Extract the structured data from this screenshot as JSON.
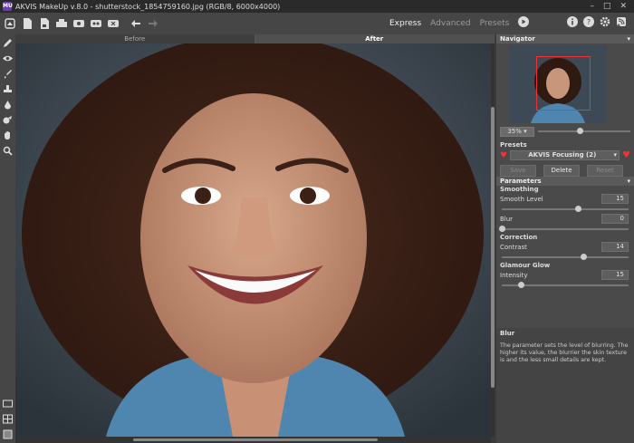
{
  "app": {
    "title": "AKVIS MakeUp v.8.0 - shutterstock_1854759160.jpg (RGB/8, 6000x4000)",
    "logo_text": "MU"
  },
  "window_controls": [
    "–",
    "□",
    "✕"
  ],
  "toolbar": {
    "icons": [
      "home-icon",
      "open-file-icon",
      "save-file-icon",
      "print-icon",
      "share-icon",
      "batch-icon",
      "plugin-icon",
      "undo-icon",
      "redo-icon"
    ],
    "modes": [
      "Express",
      "Advanced",
      "Presets"
    ],
    "active_mode": "Express"
  },
  "view_tabs": {
    "before": "Before",
    "after": "After",
    "active": "After"
  },
  "navigator": {
    "title": "Navigator",
    "zoom": "35%",
    "zoom_level": 0.45
  },
  "presets": {
    "title": "Presets",
    "selected": "AKVIS Focusing (2)",
    "save": "Save",
    "delete": "Delete",
    "reset": "Reset"
  },
  "parameters": {
    "title": "Parameters",
    "groups": [
      {
        "name": "Smoothing",
        "params": [
          {
            "label": "Smooth Level",
            "value": "15",
            "fraction": 0.6
          },
          {
            "label": "Blur",
            "value": "0",
            "fraction": 0.0
          }
        ]
      },
      {
        "name": "Correction",
        "params": [
          {
            "label": "Contrast",
            "value": "14",
            "fraction": 0.64
          }
        ]
      },
      {
        "name": "Glamour Glow",
        "params": [
          {
            "label": "Intensity",
            "value": "15",
            "fraction": 0.15
          }
        ]
      }
    ]
  },
  "help": {
    "title": "Blur",
    "text": "The parameter sets the level of blurring. The higher its value, the blurrier the skin texture is and the less small details are kept."
  },
  "colors": {
    "accent_frame": "#e33333",
    "panel_bg": "#4a4a4a"
  }
}
